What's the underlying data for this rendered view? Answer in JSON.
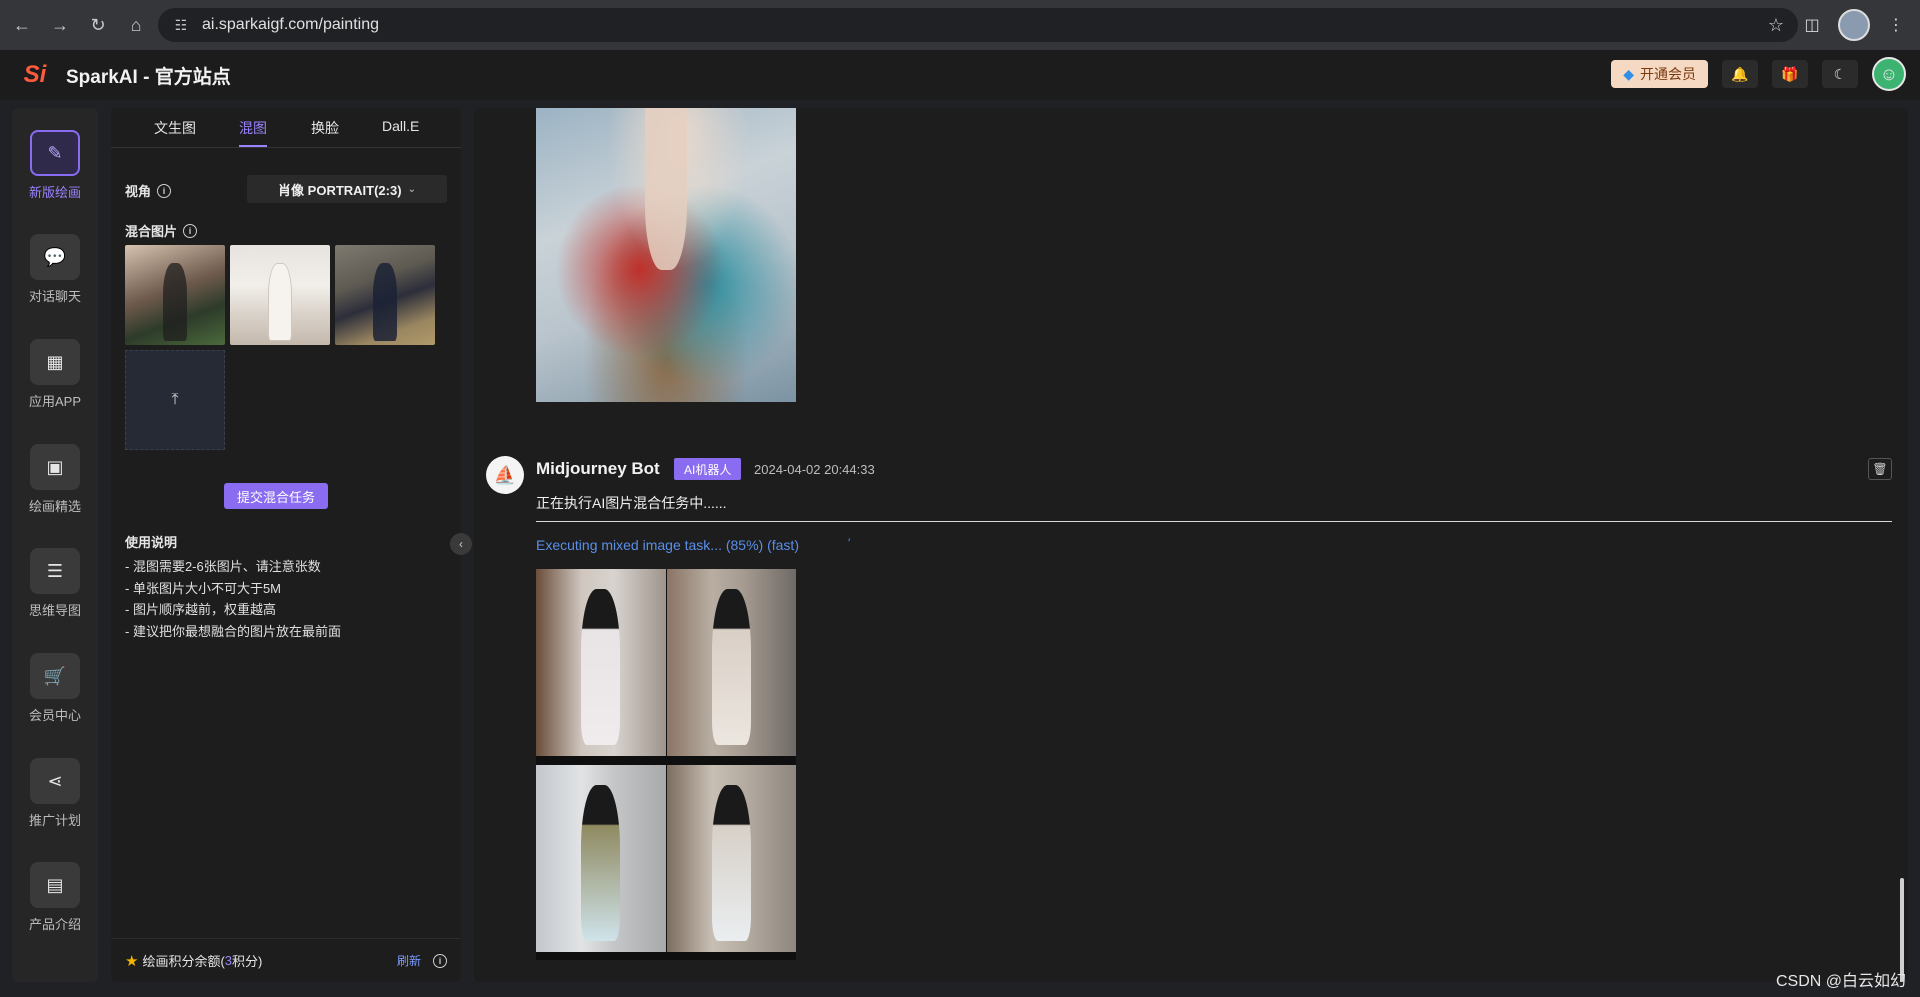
{
  "browser": {
    "url": "ai.sparkaigf.com/painting"
  },
  "header": {
    "logo": "Si",
    "title": "SparkAI - 官方站点",
    "vip_label": "开通会员"
  },
  "nav": {
    "items": [
      {
        "label": "新版绘画",
        "icon": "paint-brush-icon",
        "active": true
      },
      {
        "label": "对话聊天",
        "icon": "chat-icon",
        "active": false
      },
      {
        "label": "应用APP",
        "icon": "apps-grid-icon",
        "active": false
      },
      {
        "label": "绘画精选",
        "icon": "gallery-icon",
        "active": false
      },
      {
        "label": "思维导图",
        "icon": "mindmap-icon",
        "active": false
      },
      {
        "label": "会员中心",
        "icon": "cart-icon",
        "active": false
      },
      {
        "label": "推广计划",
        "icon": "share-icon",
        "active": false
      },
      {
        "label": "产品介绍",
        "icon": "product-icon",
        "active": false
      }
    ]
  },
  "panel": {
    "tabs": [
      "文生图",
      "混图",
      "换脸",
      "Dall.E"
    ],
    "active_tab": "混图",
    "view_label": "视角",
    "view_value": "肖像 PORTRAIT(2:3)",
    "mix_label": "混合图片",
    "submit_label": "提交混合任务",
    "usage_title": "使用说明",
    "usage": [
      "- 混图需要2-6张图片、请注意张数",
      "- 单张图片大小不可大于5M",
      "- 图片顺序越前，权重越高",
      "- 建议把你最想融合的图片放在最前面"
    ],
    "balance_prefix": "绘画积分余额(",
    "balance_value": "3",
    "balance_suffix": "积分)",
    "refresh_label": "刷新"
  },
  "message": {
    "bot_name": "Midjourney Bot",
    "badge": "AI机器人",
    "time": "2024-04-02 20:44:33",
    "text": "正在执行AI图片混合任务中......",
    "progress_text": "Executing mixed image task...  (85%)  (fast)",
    "progress": 0.85
  },
  "watermark": "CSDN @白云如幻",
  "colors": {
    "accent": "#8a6cf0",
    "link": "#5a8fe8",
    "background": "#1d1d1d"
  }
}
